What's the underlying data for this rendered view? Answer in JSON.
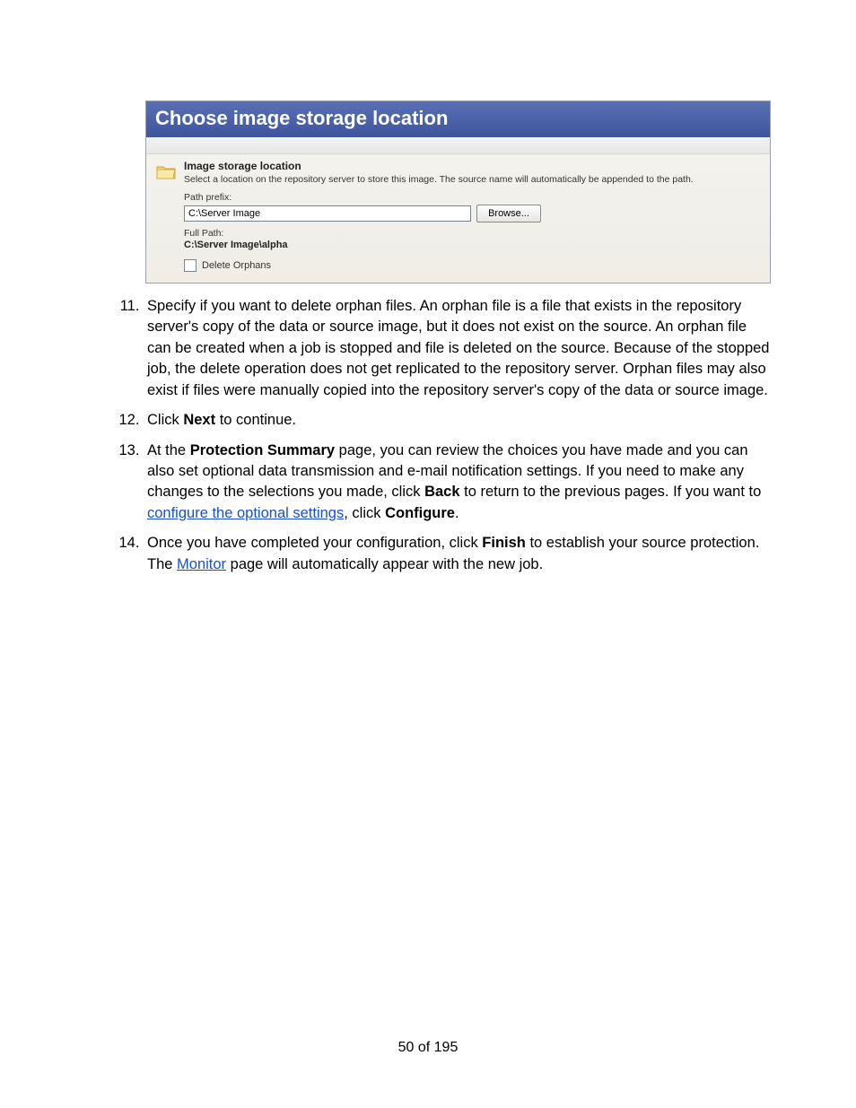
{
  "dialog": {
    "title": "Choose image storage location",
    "section_heading": "Image storage location",
    "section_desc": "Select a location on the repository server to store this image. The source name will automatically be appended to the path.",
    "path_prefix_label": "Path prefix:",
    "path_prefix_value": "C:\\Server Image",
    "browse_label": "Browse...",
    "full_path_label": "Full Path:",
    "full_path_value": "C:\\Server Image\\alpha",
    "delete_orphans_label": "Delete Orphans"
  },
  "steps": {
    "start": 11,
    "item11": "Specify if you want to delete orphan files. An orphan file is a file that exists in the repository server's copy of the data or source image, but it does not exist on the source. An orphan file can be created when a job is stopped and file is deleted on the source. Because of the stopped job, the delete operation does not get replicated to the repository server. Orphan files may also exist if files were manually copied into the repository server's copy of the data or source image.",
    "item12_a": "Click ",
    "item12_bold": "Next",
    "item12_b": " to continue.",
    "item13_a": "At the ",
    "item13_bold1": "Protection Summary",
    "item13_b": " page, you can review the choices you have made and you can also set optional data transmission and e-mail notification settings. If you need to make any changes to the selections you made, click ",
    "item13_bold2": "Back",
    "item13_c": " to return to the previous pages. If you want to ",
    "item13_link": "configure the optional settings",
    "item13_d": ", click ",
    "item13_bold3": "Configure",
    "item13_e": ".",
    "item14_a": "Once you have completed your configuration, click ",
    "item14_bold": "Finish",
    "item14_b": " to establish your source protection. The ",
    "item14_link": "Monitor",
    "item14_c": " page will automatically appear with the new job."
  },
  "footer": "50 of 195"
}
